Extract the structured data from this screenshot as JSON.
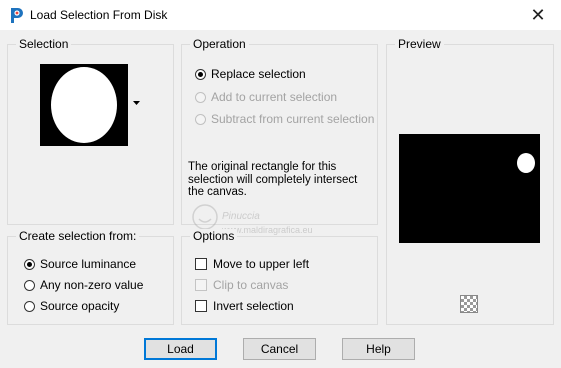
{
  "window": {
    "title": "Load Selection From Disk",
    "close_glyph": "✕"
  },
  "selection": {
    "title": "Selection",
    "dropdown_icon": "dropdown-arrow-icon"
  },
  "operation": {
    "title": "Operation",
    "options": [
      {
        "label": "Replace selection",
        "checked": true,
        "enabled": true
      },
      {
        "label": "Add to current selection",
        "checked": false,
        "enabled": false
      },
      {
        "label": "Subtract from current selection",
        "checked": false,
        "enabled": false
      }
    ],
    "info_text": "The original rectangle for this selection will completely intersect the canvas."
  },
  "preview": {
    "title": "Preview",
    "toggle_icon": "checkerboard-icon"
  },
  "create_from": {
    "title": "Create selection from:",
    "options": [
      {
        "label": "Source luminance",
        "checked": true
      },
      {
        "label": "Any non-zero value",
        "checked": false
      },
      {
        "label": "Source opacity",
        "checked": false
      }
    ]
  },
  "options": {
    "title": "Options",
    "items": [
      {
        "label": "Move to upper left",
        "checked": false,
        "enabled": true
      },
      {
        "label": "Clip to canvas",
        "checked": false,
        "enabled": false
      },
      {
        "label": "Invert selection",
        "checked": false,
        "enabled": true
      }
    ]
  },
  "watermark": {
    "name": "Pinuccia",
    "url": "www.maldiragrafica.eu"
  },
  "buttons": {
    "load": "Load",
    "cancel": "Cancel",
    "help": "Help"
  },
  "colors": {
    "accent": "#0078d7",
    "preview_bg": "#000000",
    "shape": "#ffffff"
  }
}
